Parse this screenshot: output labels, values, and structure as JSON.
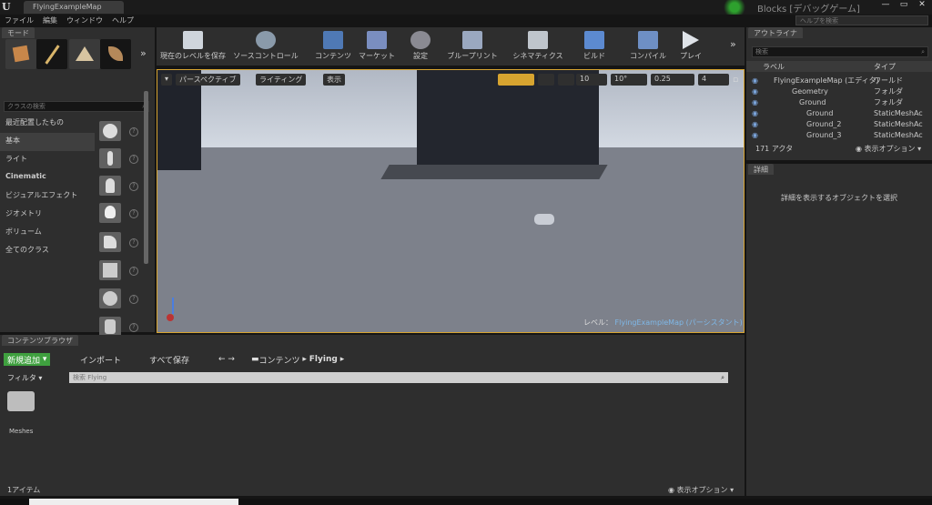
{
  "window": {
    "tab_title": "FlyingExampleMap",
    "project_title": "Blocks [デバッグゲーム]",
    "help_search_placeholder": "ヘルプを検索"
  },
  "menu": [
    "ファイル",
    "編集",
    "ウィンドウ",
    "ヘルプ"
  ],
  "modes": {
    "tab_label": "モード",
    "search_placeholder": "クラスの検索",
    "categories": [
      "最近配置したもの",
      "基本",
      "ライト",
      "Cinematic",
      "ビジュアルエフェクト",
      "ジオメトリ",
      "ボリューム",
      "全てのクラス"
    ],
    "selected_category": "基本"
  },
  "toolbar": [
    "現在のレベルを保存",
    "ソースコントロール",
    "コンテンツ",
    "マーケット",
    "設定",
    "ブループリント",
    "シネマティクス",
    "ビルド",
    "コンパイル",
    "プレイ"
  ],
  "viewport": {
    "perspective_label": "パースペクティブ",
    "lighting_label": "ライティング",
    "show_label": "表示",
    "grid_snap": "10",
    "rotation_snap": "10°",
    "scale_snap": "0.25",
    "camera_speed": "4",
    "level_label": "レベル：",
    "level_name": "FlyingExampleMap (パーシスタント)"
  },
  "outliner": {
    "tab_label": "アウトライナ",
    "search_placeholder": "検索",
    "col_label": "ラベル",
    "col_type": "タイプ",
    "rows": [
      {
        "label": "FlyingExampleMap (エディタ)",
        "type": "ワールド"
      },
      {
        "label": "Geometry",
        "type": "フォルダ"
      },
      {
        "label": "Ground",
        "type": "フォルダ"
      },
      {
        "label": "Ground",
        "type": "StaticMeshAc"
      },
      {
        "label": "Ground_2",
        "type": "StaticMeshAc"
      },
      {
        "label": "Ground_3",
        "type": "StaticMeshAc"
      }
    ],
    "actor_count": "171 アクタ",
    "view_options": "表示オプション"
  },
  "details": {
    "tab_label": "詳細",
    "empty_message": "詳細を表示するオブジェクトを選択"
  },
  "content_browser": {
    "tab_label": "コンテンツブラウザ",
    "add_new": "新規追加",
    "import": "インポート",
    "save_all": "すべて保存",
    "path": [
      "コンテンツ",
      "Flying"
    ],
    "filter": "フィルタ",
    "search_placeholder": "検索 Flying",
    "folder_name": "Meshes",
    "item_count": "1アイテム",
    "view_options": "表示オプション"
  },
  "colors": {
    "accent_orange": "#d7a430",
    "add_green": "#3fa03f",
    "eye_blue": "#7aa3d9"
  }
}
